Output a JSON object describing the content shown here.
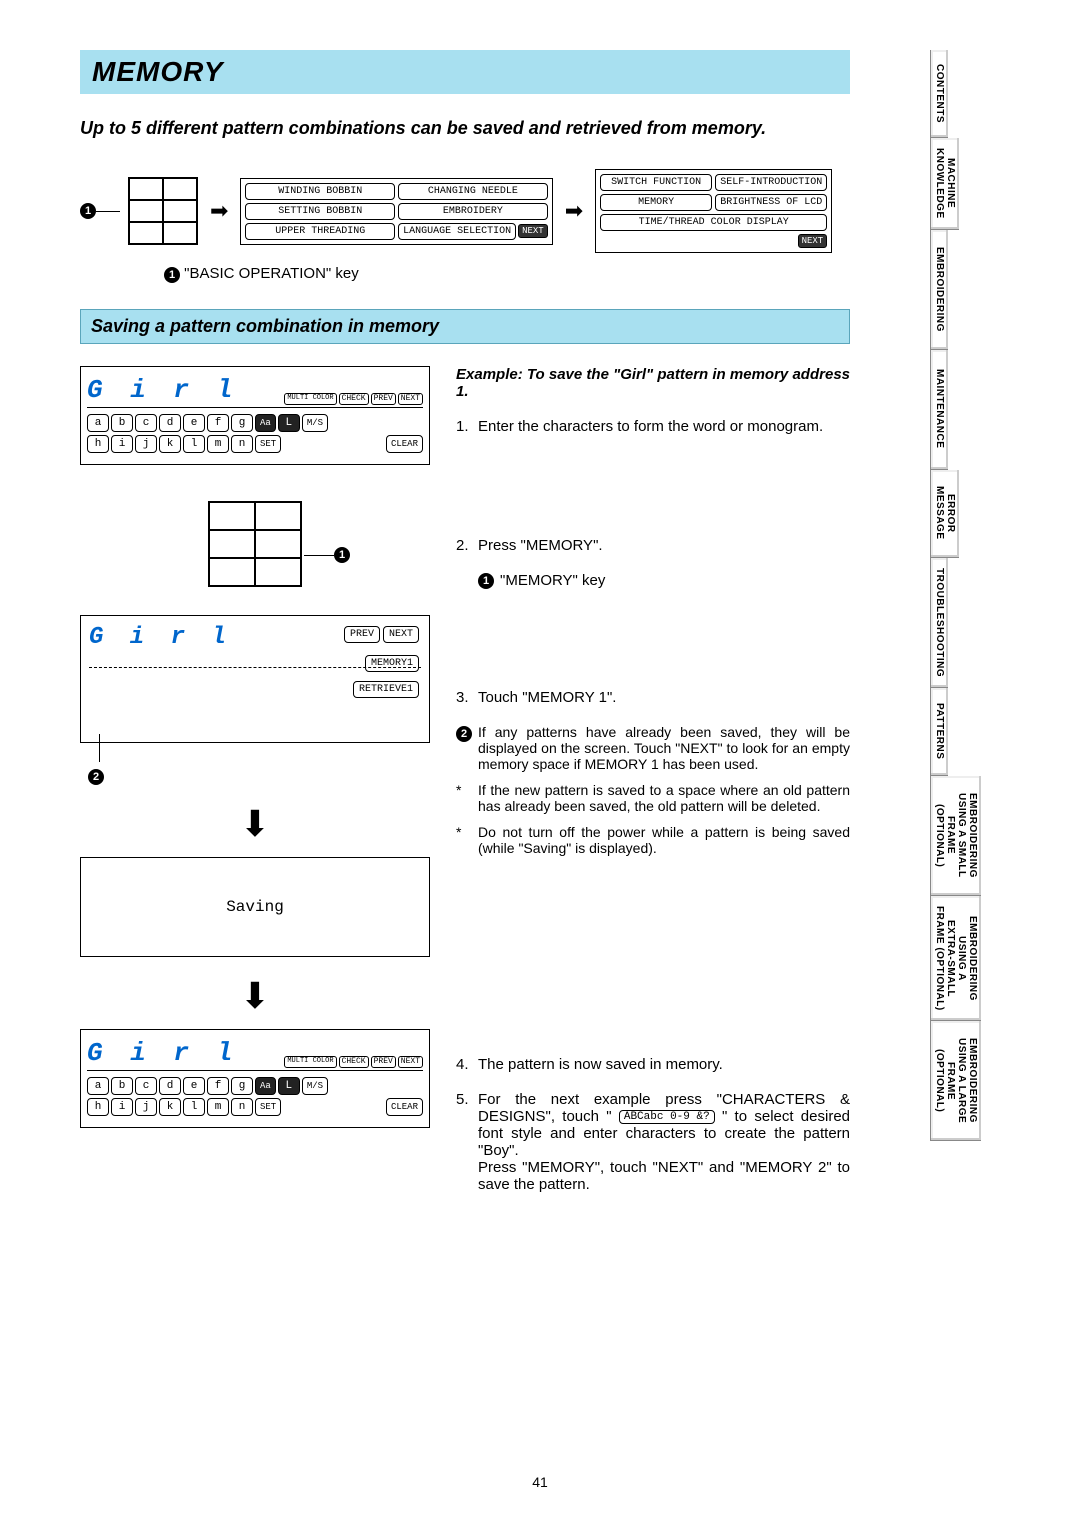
{
  "title": "MEMORY",
  "intro": "Up to 5 different pattern combinations can be saved and retrieved from memory.",
  "callout1": "\"BASIC OPERATION\" key",
  "lcd1": {
    "b1": "WINDING BOBBIN",
    "b2": "CHANGING NEEDLE",
    "b3": "SETTING BOBBIN",
    "b4": "EMBROIDERY",
    "b5": "UPPER THREADING",
    "b6": "LANGUAGE SELECTION",
    "next": "NEXT"
  },
  "lcd2": {
    "b1": "SWITCH FUNCTION",
    "b2": "SELF-INTRODUCTION",
    "b3": "MEMORY",
    "b4": "BRIGHTNESS OF LCD",
    "b5": "TIME/THREAD COLOR DISPLAY",
    "next": "NEXT"
  },
  "section": "Saving a pattern combination in memory",
  "example": "Example: To save the \"Girl\" pattern in memory address 1.",
  "steps": {
    "s1n": "1.",
    "s1": "Enter the characters to form the word or monogram.",
    "s2n": "2.",
    "s2": "Press \"MEMORY\".",
    "memkey": "\"MEMORY\" key",
    "s3n": "3.",
    "s3": "Touch \"MEMORY 1\".",
    "s4n": "4.",
    "s4": "The pattern is now saved in memory.",
    "s5n": "5.",
    "s5a": "For the next example press \"CHARACTERS & DESIGNS\", touch \" ",
    "s5btn": "ABCabc 0-9 &?",
    "s5b": " \" to select desired font style and enter characters to create the pattern \"Boy\".",
    "s5c": "Press \"MEMORY\", touch \"NEXT\" and \"MEMORY 2\" to save the pattern."
  },
  "notes": {
    "n2mark": "2",
    "n2": "If any patterns have already been saved, they will be displayed on the screen. Touch \"NEXT\" to look for an empty memory space if MEMORY 1 has been used.",
    "star1": "If the new pattern is saved to a space where an old pattern has already been saved, the old pattern will be deleted.",
    "star2": "Do not turn off the power while a pattern is being saved (while \"Saving\" is displayed)."
  },
  "charscreen": {
    "girl": "G i r l",
    "multi": "MULTI COLOR",
    "check": "CHECK",
    "prev": "PREV",
    "next": "NEXT",
    "rowA": [
      "a",
      "b",
      "c",
      "d",
      "e",
      "f",
      "g"
    ],
    "aa": "Aa",
    "L": "L",
    "ms": "M/S",
    "rowB": [
      "h",
      "i",
      "j",
      "k",
      "l",
      "m",
      "n"
    ],
    "set": "SET",
    "clear": "CLEAR"
  },
  "memscreen": {
    "girl": "G i r l",
    "prev": "PREV",
    "next": "NEXT",
    "mem1": "MEMORY1",
    "ret1": "RETRIEVE1"
  },
  "saving": "Saving",
  "marker1": "1",
  "marker2": "2",
  "page": "41",
  "tabs": {
    "t1": "CONTENTS",
    "t2": "MACHINE\nKNOWLEDGE",
    "t3": "EMBROIDERING",
    "t4": "MAINTENANCE",
    "t5": "ERROR\nMESSAGE",
    "t6": "TROUBLESHOOTING",
    "t7": "PATTERNS",
    "t8": "EMBROIDERING\nUSING A SMALL\nFRAME\n(OPTIONAL)",
    "t9": "EMBROIDERING\nUSING A\nEXTRA-SMALL\nFRAME (OPTIONAL)",
    "t10": "EMBROIDERING\nUSING A LARGE\nFRAME\n(OPTIONAL)"
  }
}
